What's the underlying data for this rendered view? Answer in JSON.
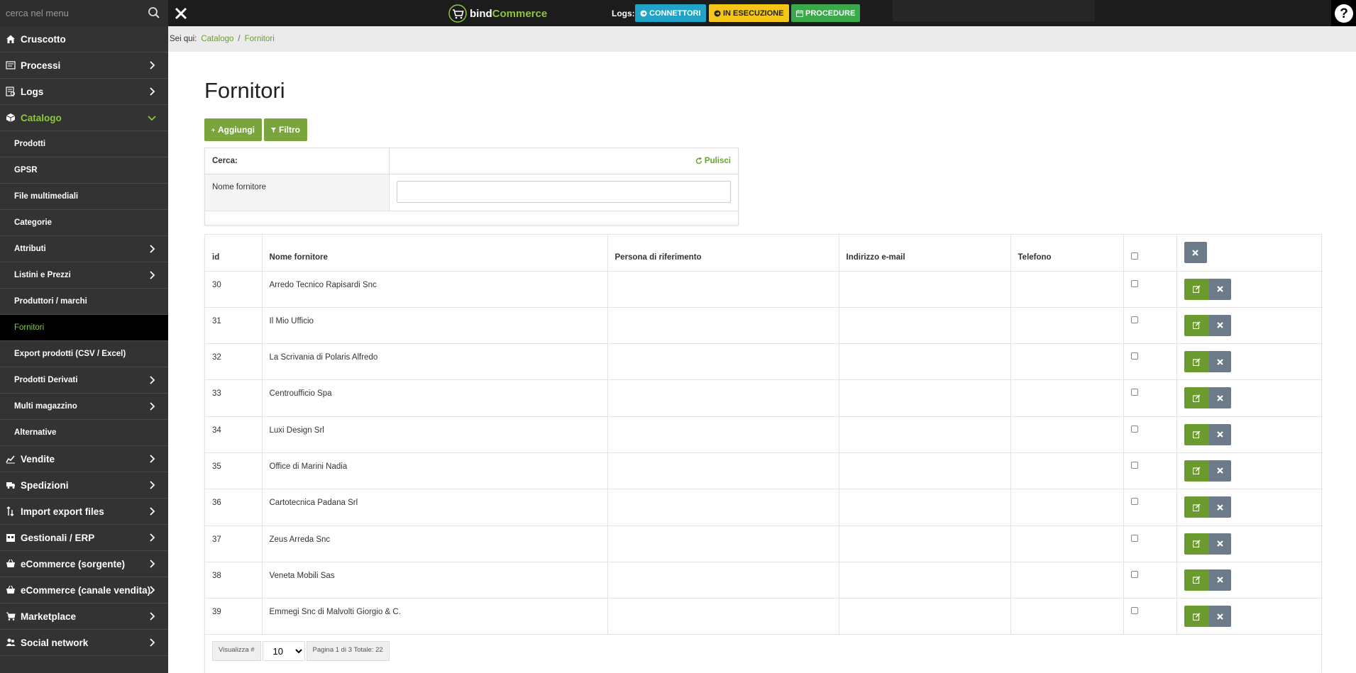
{
  "topbar": {
    "search_placeholder": "cerca nel menu",
    "logo_part1": "bind",
    "logo_part2": "Commerce",
    "logs_label": "Logs:",
    "btn_connettori": "CONNETTORI",
    "btn_esecuzione": "IN ESECUZIONE",
    "btn_procedure": "PROCEDURE",
    "help_label": "?"
  },
  "sidebar": {
    "items": [
      {
        "label": "Cruscotto",
        "icon": "home-icon"
      },
      {
        "label": "Processi",
        "icon": "processes-icon"
      },
      {
        "label": "Logs",
        "icon": "logs-icon"
      },
      {
        "label": "Catalogo",
        "icon": "cube-icon"
      }
    ],
    "catalog_sub": [
      {
        "label": "Prodotti"
      },
      {
        "label": "GPSR"
      },
      {
        "label": "File multimediali"
      },
      {
        "label": "Categorie"
      },
      {
        "label": "Attributi"
      },
      {
        "label": "Listini e Prezzi"
      },
      {
        "label": "Produttori / marchi"
      },
      {
        "label": "Fornitori"
      },
      {
        "label": "Export prodotti (CSV / Excel)"
      },
      {
        "label": "Prodotti Derivati"
      },
      {
        "label": "Multi magazzino"
      },
      {
        "label": "Alternative"
      }
    ],
    "items_after": [
      {
        "label": "Vendite",
        "icon": "chart-icon"
      },
      {
        "label": "Spedizioni",
        "icon": "truck-icon"
      },
      {
        "label": "Import export files",
        "icon": "sort-icon"
      },
      {
        "label": "Gestionali / ERP",
        "icon": "calendar-icon"
      },
      {
        "label": "eCommerce (sorgente)",
        "icon": "basket-icon"
      },
      {
        "label": "eCommerce (canale vendita)",
        "icon": "basket-icon"
      },
      {
        "label": "Marketplace",
        "icon": "cart-icon"
      },
      {
        "label": "Social network",
        "icon": "users-icon"
      }
    ]
  },
  "breadcrumb": {
    "prefix": "Sei qui:",
    "items": [
      "Catalogo",
      "Fornitori"
    ],
    "separator": "/"
  },
  "page": {
    "title": "Fornitori",
    "add_label": "Aggiungi",
    "filter_label": "Filtro"
  },
  "filter_panel": {
    "search_label": "Cerca:",
    "clear_label": "Pulisci",
    "field_label": "Nome fornitore",
    "field_value": ""
  },
  "table": {
    "headers": [
      "id",
      "Nome fornitore",
      "Persona di riferimento",
      "Indirizzo e-mail",
      "Telefono"
    ],
    "rows": [
      {
        "id": "30",
        "name": "Arredo Tecnico Rapisardi Snc",
        "contact": "",
        "email": "",
        "phone": ""
      },
      {
        "id": "31",
        "name": "Il Mio Ufficio",
        "contact": "",
        "email": "",
        "phone": ""
      },
      {
        "id": "32",
        "name": "La Scrivania di Polaris Alfredo",
        "contact": "",
        "email": "",
        "phone": ""
      },
      {
        "id": "33",
        "name": "Centroufficio Spa",
        "contact": "",
        "email": "",
        "phone": ""
      },
      {
        "id": "34",
        "name": "Luxi Design Srl",
        "contact": "",
        "email": "",
        "phone": ""
      },
      {
        "id": "35",
        "name": "Office di Marini Nadia",
        "contact": "",
        "email": "",
        "phone": ""
      },
      {
        "id": "36",
        "name": "Cartotecnica Padana Srl",
        "contact": "",
        "email": "",
        "phone": ""
      },
      {
        "id": "37",
        "name": "Zeus Arreda Snc",
        "contact": "",
        "email": "",
        "phone": ""
      },
      {
        "id": "38",
        "name": "Veneta Mobili Sas",
        "contact": "",
        "email": "",
        "phone": ""
      },
      {
        "id": "39",
        "name": "Emmegi Snc di Malvolti Giorgio & C.",
        "contact": "",
        "email": "",
        "phone": ""
      }
    ]
  },
  "pager": {
    "show_label": "Visualizza #",
    "page_size": "10",
    "page_info": "Pagina 1 di 3 Totale: 22"
  },
  "colors": {
    "accent_green": "#8dc63f",
    "button_green": "#7aa53d",
    "sidebar_bg": "#333333",
    "connettori": "#1fa3c7",
    "esecuzione": "#f5c518",
    "procedure": "#3aa94a"
  }
}
